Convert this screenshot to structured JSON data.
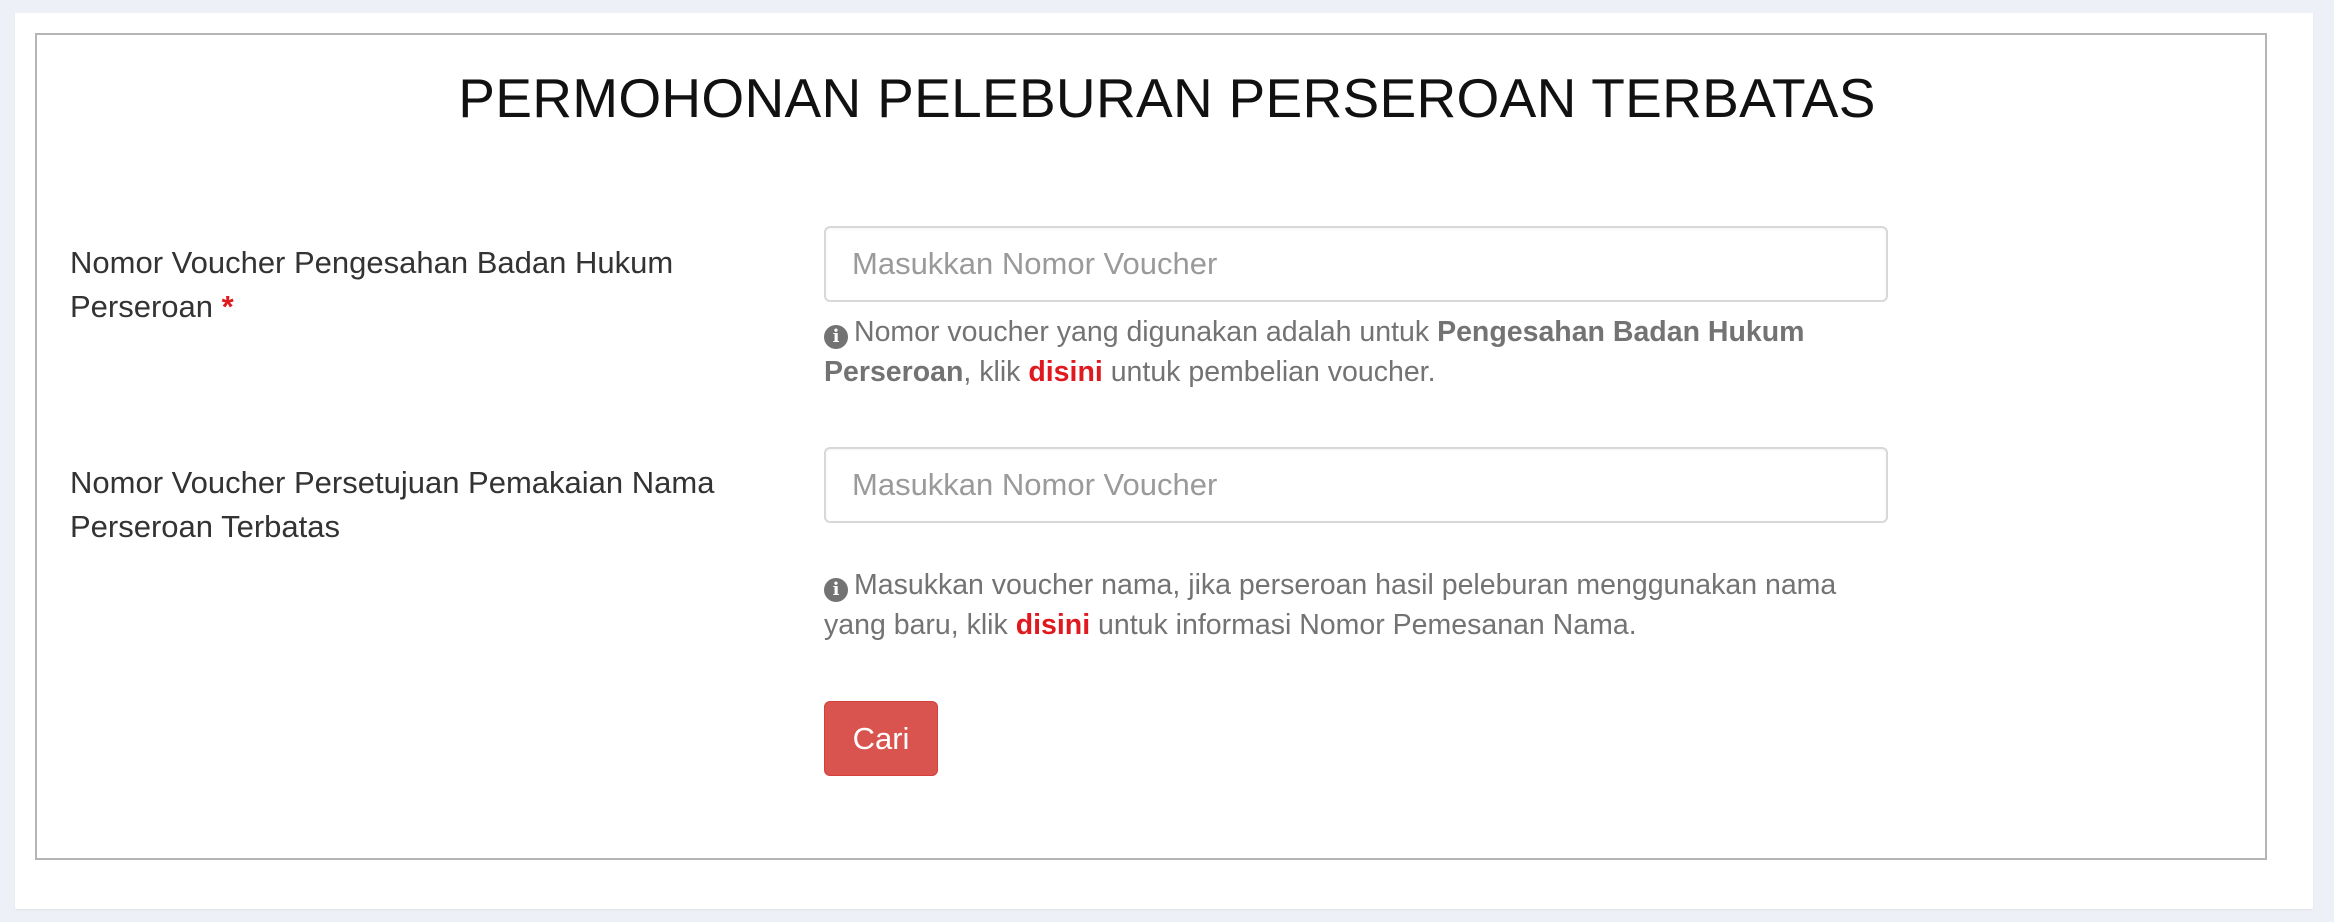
{
  "page": {
    "title": "PERMOHONAN PELEBURAN PERSEROAN TERBATAS"
  },
  "fields": [
    {
      "label": "Nomor Voucher Pengesahan Badan Hukum Perseroan",
      "required_marker": "*",
      "placeholder": "Masukkan Nomor Voucher",
      "value": "",
      "help": {
        "text_before": "Nomor voucher yang digunakan adalah untuk",
        "bold": "Pengesahan Badan Hukum Perseroan",
        "text_middle": ", klik",
        "link": "disini",
        "text_after": "untuk pembelian voucher."
      }
    },
    {
      "label": "Nomor Voucher Persetujuan Pemakaian Nama Perseroan Terbatas",
      "placeholder": "Masukkan Nomor Voucher",
      "value": "",
      "help": {
        "text_before": "Masukkan voucher nama, jika perseroan hasil peleburan menggunakan nama yang baru, klik",
        "link": "disini",
        "text_after": "untuk informasi Nomor Pemesanan Nama."
      }
    }
  ],
  "actions": {
    "search_label": "Cari"
  },
  "colors": {
    "required": "#e0191f",
    "link": "#e0191f",
    "button": "#d9534f",
    "help_text": "#737373"
  },
  "icons": {
    "help": "info-circle-icon"
  }
}
